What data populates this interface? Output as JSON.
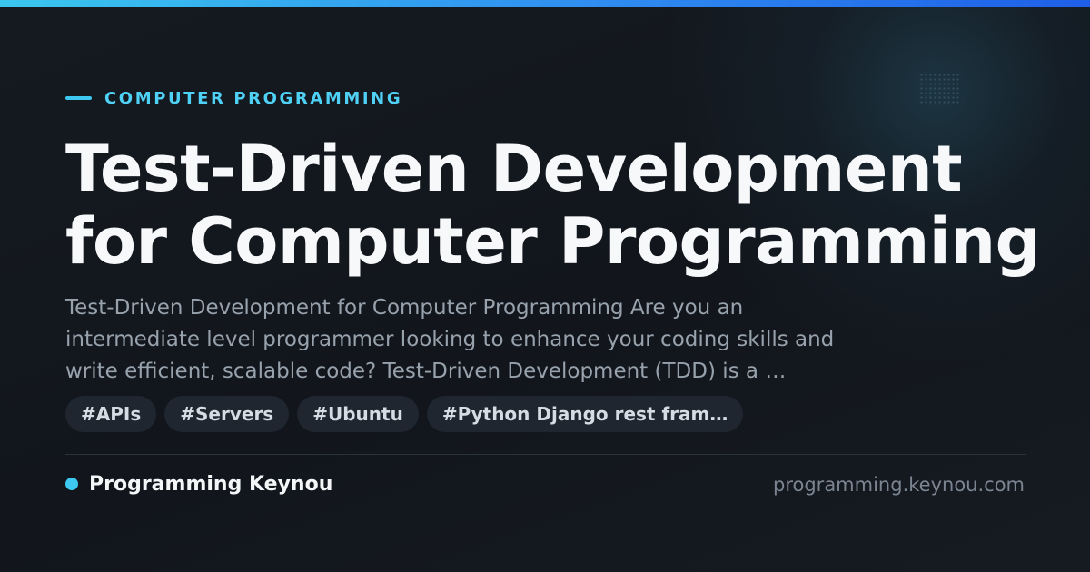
{
  "category": "COMPUTER PROGRAMMING",
  "title_lines": [
    "Test-Driven Development",
    "for Computer Programming"
  ],
  "description_lines": [
    "Test-Driven Development for Computer Programming Are you an",
    "intermediate level programmer looking to enhance your coding skills and",
    "write efficient, scalable code? Test-Driven Development (TDD) is a …"
  ],
  "tags": [
    "#APIs",
    "#Servers",
    "#Ubuntu",
    "#Python Django rest fram…"
  ],
  "brand": {
    "name": "Programming Keynou",
    "domain": "programming.keynou.com"
  },
  "colors": {
    "accent": "#3cc8f0",
    "background": "#14181f",
    "title": "#f6f8fa"
  }
}
